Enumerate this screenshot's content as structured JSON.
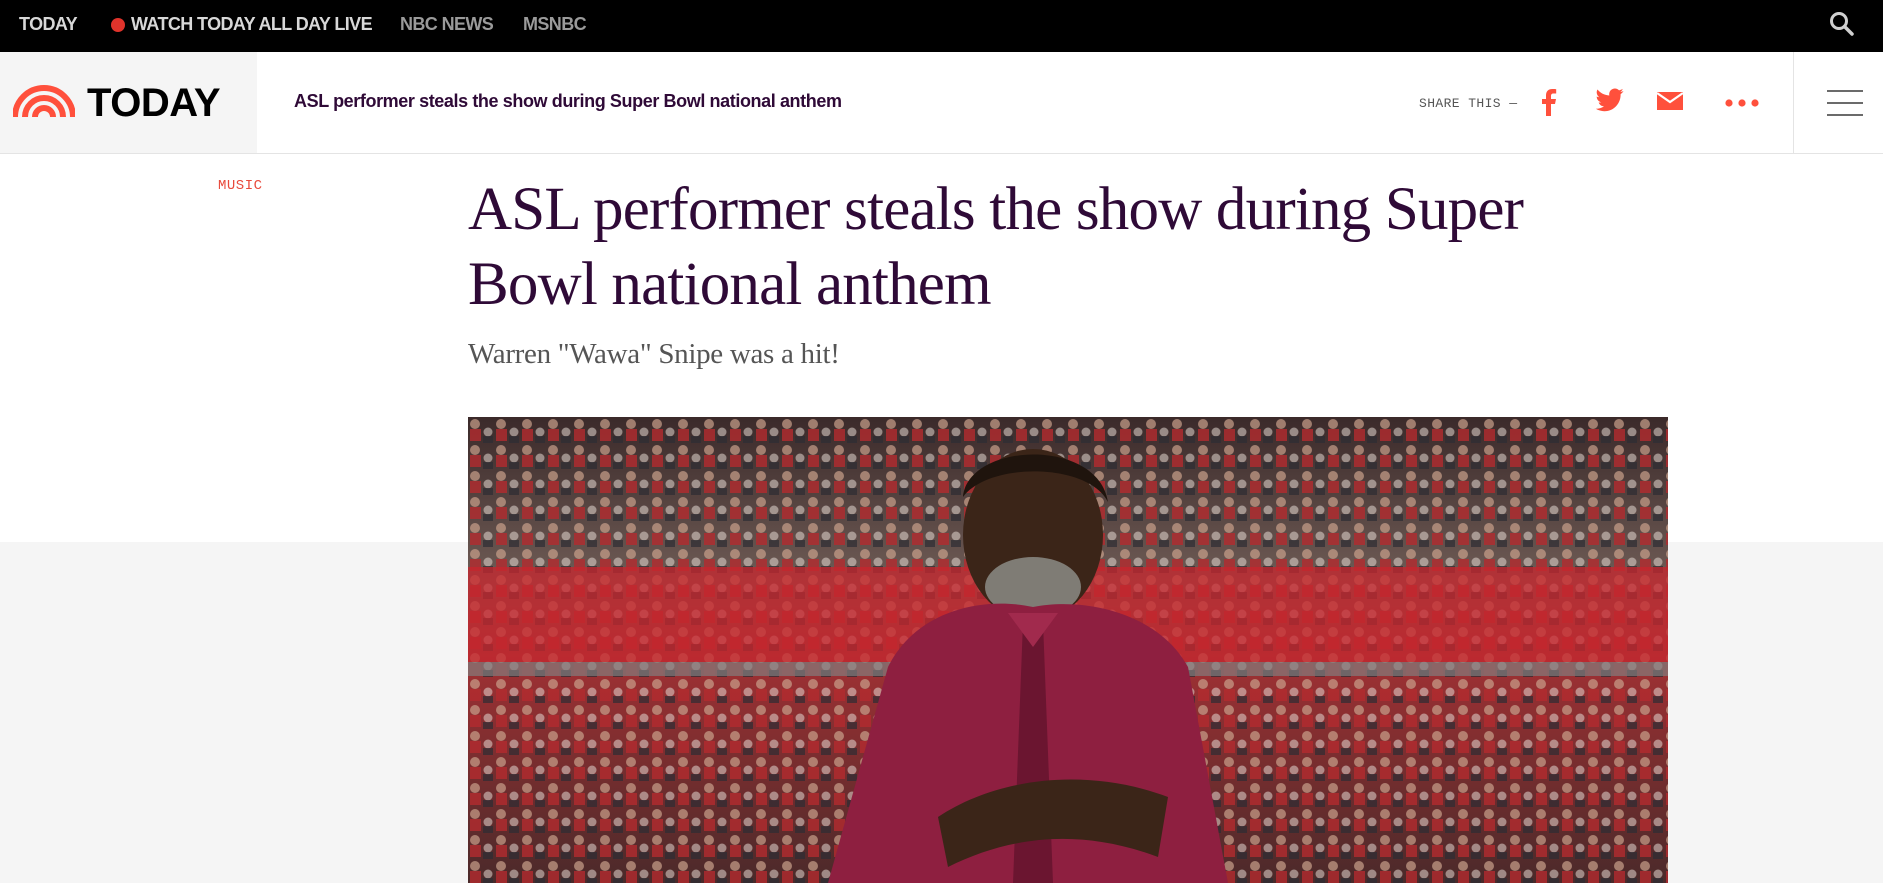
{
  "top_nav": {
    "today": "TODAY",
    "watch_live": "WATCH TODAY ALL DAY LIVE",
    "nbc_news": "NBC NEWS",
    "msnbc": "MSNBC",
    "search_icon": "search-icon"
  },
  "header": {
    "logo_text": "TODAY",
    "article_title": "ASL performer steals the show during Super Bowl national anthem",
    "share_label": "SHARE THIS —",
    "share_icons": [
      "facebook-icon",
      "twitter-icon",
      "mail-icon",
      "more-icon"
    ],
    "menu_icon": "hamburger-menu-icon"
  },
  "article": {
    "category": "MUSIC",
    "headline": "ASL performer steals the show during Super Bowl national anthem",
    "dek": "Warren \"Wawa\" Snipe was a hit!",
    "hero_image_subject": "performer in maroon shirt signing in front of stadium crowd"
  },
  "colors": {
    "brand_orange": "#ff503c",
    "headline_purple": "#2f0a37",
    "category_red": "#e84a3c",
    "topbar_black": "#000000"
  }
}
